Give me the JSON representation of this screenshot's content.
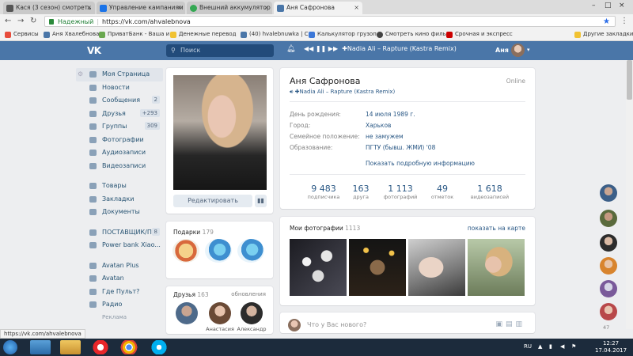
{
  "browser": {
    "tabs": [
      {
        "title": "Кася (3 сезон) смотреть",
        "icon_color": "#555"
      },
      {
        "title": "Управление кампаниям",
        "icon_color": "#1a73e8"
      },
      {
        "title": "Внешний аккумулятор д",
        "icon_color": "#34a853"
      },
      {
        "title": "Аня Сафронова",
        "icon_color": "#4a76a8"
      }
    ],
    "address": {
      "secure_label": "Надежный",
      "url": "https://vk.com/ahvalebnova"
    },
    "bookmarks": [
      {
        "label": "Сервисы",
        "color": "#e74c3c"
      },
      {
        "label": "Аня Хвалебнова",
        "color": "#4a76a8"
      },
      {
        "label": "ПриватБанк - Ваша и",
        "color": "#6aa84f"
      },
      {
        "label": "Денежные перевод",
        "color": "#f1c232"
      },
      {
        "label": "(40) hvalebnuwka | С",
        "color": "#4a76a8"
      },
      {
        "label": "Калькулятор грузоп",
        "color": "#3c78d8"
      },
      {
        "label": "Смотреть кино филь",
        "color": "#444"
      },
      {
        "label": "Срочная и экспресс",
        "color": "#cc0000"
      },
      {
        "label": "Другие закладки",
        "color": "#f1c232"
      }
    ],
    "status_url": "https://vk.com/ahvalebnova"
  },
  "vk_header": {
    "logo": "VK",
    "search_placeholder": "Поиск",
    "player_track": "✚Nadia Ali – Rapture (Kastra Remix)",
    "user_name": "Аня"
  },
  "left_menu": {
    "items": [
      {
        "label": "Моя Страница",
        "count": ""
      },
      {
        "label": "Новости",
        "count": ""
      },
      {
        "label": "Сообщения",
        "count": "2"
      },
      {
        "label": "Друзья",
        "count": "+293"
      },
      {
        "label": "Группы",
        "count": "309"
      },
      {
        "label": "Фотографии",
        "count": ""
      },
      {
        "label": "Аудиозаписи",
        "count": ""
      },
      {
        "label": "Видеозаписи",
        "count": ""
      }
    ],
    "items2": [
      {
        "label": "Товары",
        "count": ""
      },
      {
        "label": "Закладки",
        "count": ""
      },
      {
        "label": "Документы",
        "count": ""
      }
    ],
    "items3": [
      {
        "label": "ПОСТАВЩИК/П...",
        "count": "8"
      },
      {
        "label": "Power bank Xiao...",
        "count": ""
      }
    ],
    "items4": [
      {
        "label": "Avatan Plus",
        "count": ""
      },
      {
        "label": "Avatan",
        "count": ""
      },
      {
        "label": "Где Пульт?",
        "count": ""
      },
      {
        "label": "Радио",
        "count": ""
      }
    ],
    "ads_label": "Реклама"
  },
  "profile_card": {
    "edit_button": "Редактировать"
  },
  "gifts": {
    "title": "Подарки",
    "count": "179"
  },
  "friends": {
    "title": "Друзья",
    "count": "163",
    "updates": "обновления",
    "names": [
      "",
      "Анастасия",
      "Александр"
    ]
  },
  "profile": {
    "name": "Аня Сафронова",
    "status": "✚Nadia Ali – Rapture (Kastra Remix)",
    "online": "Online",
    "fields": [
      {
        "label": "День рождения:",
        "value": "14 июля 1989 г."
      },
      {
        "label": "Город:",
        "value": "Харьков"
      },
      {
        "label": "Семейное положение:",
        "value": "не замужем"
      },
      {
        "label": "Образование:",
        "value": "ПГТУ (бывш. ЖМИ) '08"
      }
    ],
    "more": "Показать подробную информацию",
    "stats": [
      {
        "n": "9 483",
        "l": "подписчика"
      },
      {
        "n": "163",
        "l": "друга"
      },
      {
        "n": "1 113",
        "l": "фотографий"
      },
      {
        "n": "49",
        "l": "отметок"
      },
      {
        "n": "1 618",
        "l": "видеозаписей"
      }
    ]
  },
  "photos": {
    "title": "Мои фотографии",
    "count": "1113",
    "map_link": "показать на карте"
  },
  "post_box": {
    "placeholder": "Что у Вас нового?"
  },
  "fast_chat": {
    "count": "47"
  },
  "taskbar": {
    "lang": "RU",
    "time": "12:27",
    "date": "17.04.2017"
  }
}
